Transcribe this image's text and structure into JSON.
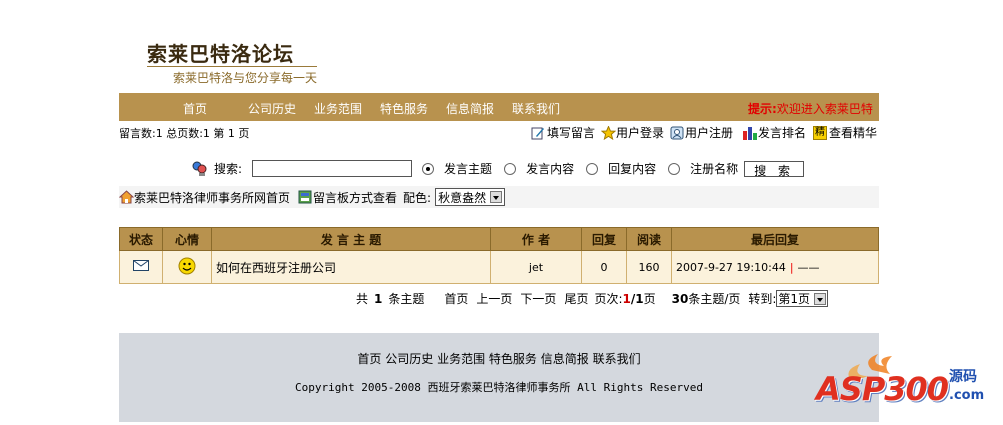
{
  "logo": {
    "title": "索莱巴特洛论坛",
    "subtitle": "索莱巴特洛与您分享每一天"
  },
  "nav": {
    "items": [
      "首页",
      "公司历史",
      "业务范围",
      "特色服务",
      "信息简报",
      "联系我们"
    ],
    "tip_label": "提示:",
    "tip_text": "欢迎进入索莱巴特"
  },
  "stats": "留言数:1 总页数:1  第 1 页",
  "toolbar": {
    "write": "填写留言",
    "login": "用户登录",
    "register": "用户注册",
    "rank": "发言排名",
    "elite": "查看精华",
    "elite_badge": "精"
  },
  "search": {
    "label": "搜索:",
    "options": [
      "发言主题",
      "发言内容",
      "回复内容",
      "注册名称"
    ],
    "selected": "发言主题",
    "button": "搜 索"
  },
  "links": {
    "home": "索莱巴特洛律师事务所网首页",
    "board_view": "留言板方式查看",
    "color_label": "配色:",
    "color_value": "秋意盎然"
  },
  "table": {
    "headers": [
      "状态",
      "心情",
      "发 言 主 题",
      "作 者",
      "回复",
      "阅读",
      "最后回复"
    ],
    "rows": [
      {
        "subject": "如何在西班牙注册公司",
        "author": "jet",
        "replies": "0",
        "views": "160",
        "last_time": "2007-9-27 19:10:44",
        "last_user": "——"
      }
    ]
  },
  "pager": {
    "total_label": "共",
    "total": "1",
    "total_suffix": "条主题",
    "first": "首页",
    "prev": "上一页",
    "next": "下一页",
    "last": "尾页",
    "page_label": "页次:",
    "page_current": "1",
    "page_total": "/1",
    "page_suffix": "页",
    "per_page": "30",
    "per_page_suffix": "条主题/页",
    "goto_label": "转到:",
    "goto_value": "第1页"
  },
  "footer": {
    "links": [
      "首页",
      "公司历史",
      "业务范围",
      "特色服务",
      "信息简报",
      "联系我们"
    ],
    "copyright": "Copyright 2005-2008 西班牙索莱巴特洛律师事务所 All Rights Reserved"
  },
  "watermark": {
    "brand": "ASP300",
    "suffix": "源码",
    "domain": ".com"
  }
}
